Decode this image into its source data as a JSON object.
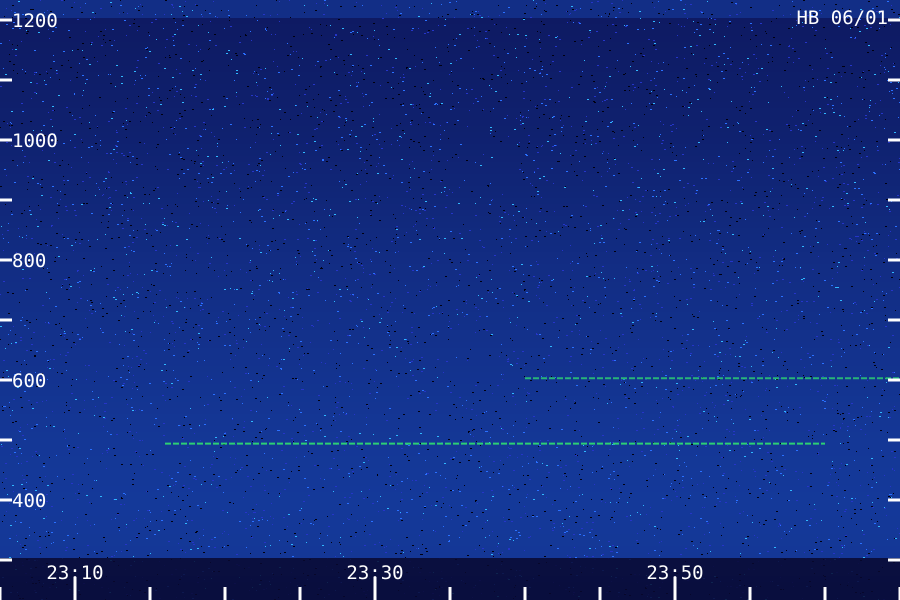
{
  "chart_data": {
    "type": "heatmap",
    "title": "",
    "annotation": "HB 06/01",
    "xlabel": "",
    "ylabel": "",
    "y_ticks": [
      {
        "value": 1200,
        "label": "1200"
      },
      {
        "value": 1000,
        "label": "1000"
      },
      {
        "value": 800,
        "label": "800"
      },
      {
        "value": 600,
        "label": "600"
      },
      {
        "value": 400,
        "label": "400"
      }
    ],
    "x_ticks": [
      {
        "value": "23:10",
        "label": "23:10"
      },
      {
        "value": "23:30",
        "label": "23:30"
      },
      {
        "value": "23:50",
        "label": "23:50"
      }
    ],
    "ylim": [
      200,
      1200
    ],
    "xlim": [
      "23:05",
      "24:05"
    ],
    "colors": {
      "background_low": "#000010",
      "noise_mid": "#2030c0",
      "noise_high": "#20a0ff",
      "signal": "#30e070"
    },
    "intensity_profile": [
      {
        "freq": 1200,
        "level": 0.18
      },
      {
        "freq": 1100,
        "level": 0.22
      },
      {
        "freq": 1000,
        "level": 0.26
      },
      {
        "freq": 900,
        "level": 0.32
      },
      {
        "freq": 800,
        "level": 0.38
      },
      {
        "freq": 700,
        "level": 0.42
      },
      {
        "freq": 600,
        "level": 0.46
      },
      {
        "freq": 500,
        "level": 0.5
      },
      {
        "freq": 400,
        "level": 0.52
      },
      {
        "freq": 300,
        "level": 0.5
      },
      {
        "freq": 200,
        "level": 0.4
      }
    ],
    "signal_lines": [
      {
        "freq": 494,
        "t_start": "23:16",
        "t_end": "24:00",
        "level": 0.9
      },
      {
        "freq": 603,
        "t_start": "23:40",
        "t_end": "24:05",
        "level": 0.75
      }
    ]
  }
}
